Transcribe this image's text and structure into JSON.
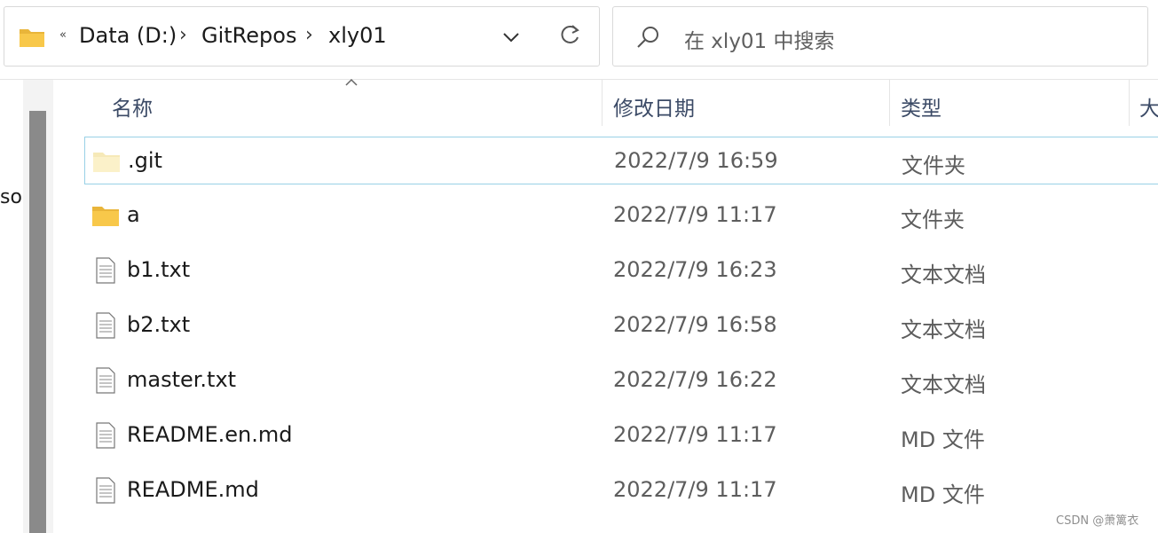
{
  "address_bar": {
    "overflow_label": "«",
    "crumbs": [
      "Data (D:)",
      "GitRepos",
      "xly01"
    ],
    "separator": "›"
  },
  "search": {
    "placeholder": "在 xly01 中搜索"
  },
  "nav": {
    "partial_label": "so"
  },
  "columns": {
    "name": "名称",
    "modified": "修改日期",
    "type": "类型",
    "size": "大"
  },
  "files": [
    {
      "name": ".git",
      "modified": "2022/7/9 16:59",
      "type": "文件夹",
      "icon": "folder-icon",
      "focused": true
    },
    {
      "name": "a",
      "modified": "2022/7/9 11:17",
      "type": "文件夹",
      "icon": "folder-icon",
      "focused": false
    },
    {
      "name": "b1.txt",
      "modified": "2022/7/9 16:23",
      "type": "文本文档",
      "icon": "text-file-icon",
      "focused": false
    },
    {
      "name": "b2.txt",
      "modified": "2022/7/9 16:58",
      "type": "文本文档",
      "icon": "text-file-icon",
      "focused": false
    },
    {
      "name": "master.txt",
      "modified": "2022/7/9 16:22",
      "type": "文本文档",
      "icon": "text-file-icon",
      "focused": false
    },
    {
      "name": "README.en.md",
      "modified": "2022/7/9 11:17",
      "type": "MD 文件",
      "icon": "text-file-icon",
      "focused": false
    },
    {
      "name": "README.md",
      "modified": "2022/7/9 11:17",
      "type": "MD 文件",
      "icon": "text-file-icon",
      "focused": false
    }
  ],
  "watermark": "CSDN @萧篱衣",
  "colors": {
    "folder_yellow": "#f8c84a",
    "focus_border": "#99d1e6",
    "header_text": "#3b4a66"
  }
}
